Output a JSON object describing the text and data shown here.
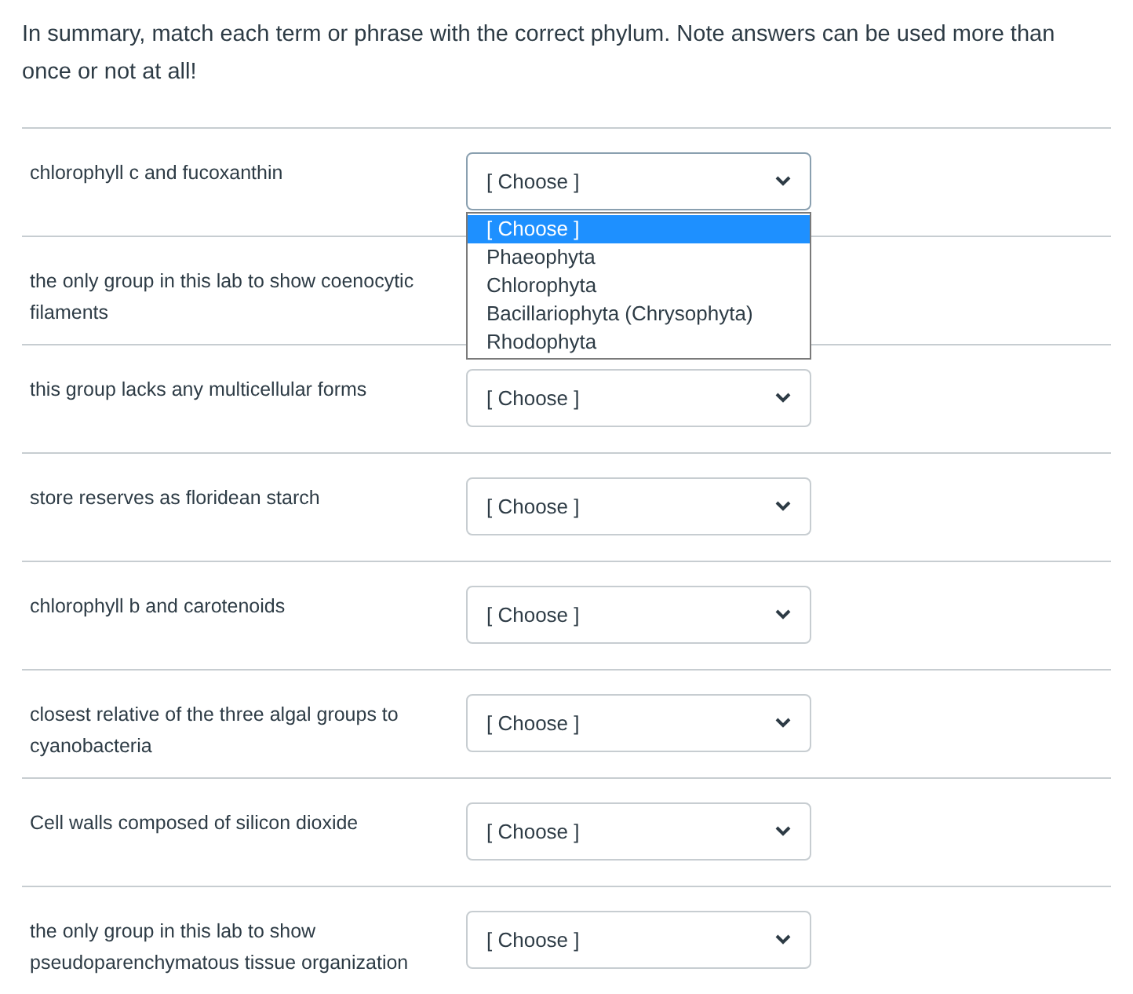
{
  "intro": "In summary, match each term or phrase with the correct phylum.  Note answers can be used more than once or not at all!",
  "rows": [
    {
      "term": "chlorophyll c and fucoxanthin",
      "value": "[ Choose ]",
      "expanded": true,
      "options": [
        {
          "label": "[ Choose ]",
          "selected": true
        },
        {
          "label": "Phaeophyta",
          "selected": false
        },
        {
          "label": "Chlorophyta",
          "selected": false
        },
        {
          "label": "Bacillariophyta (Chrysophyta)",
          "selected": false
        },
        {
          "label": "Rhodophyta",
          "selected": false
        }
      ]
    },
    {
      "term": "the only group in this lab to show coenocytic filaments"
    },
    {
      "term": "this group lacks any multicellular forms",
      "value": "[ Choose ]"
    },
    {
      "term": "store reserves as floridean starch",
      "value": "[ Choose ]"
    },
    {
      "term": "chlorophyll b and carotenoids",
      "value": "[ Choose ]"
    },
    {
      "term": "closest relative of the three algal groups to cyanobacteria",
      "value": "[ Choose ]"
    },
    {
      "term": "Cell walls composed of silicon dioxide",
      "value": "[ Choose ]"
    },
    {
      "term": "the only group in this lab to show pseudoparenchymatous tissue organization",
      "value": "[ Choose ]"
    }
  ]
}
